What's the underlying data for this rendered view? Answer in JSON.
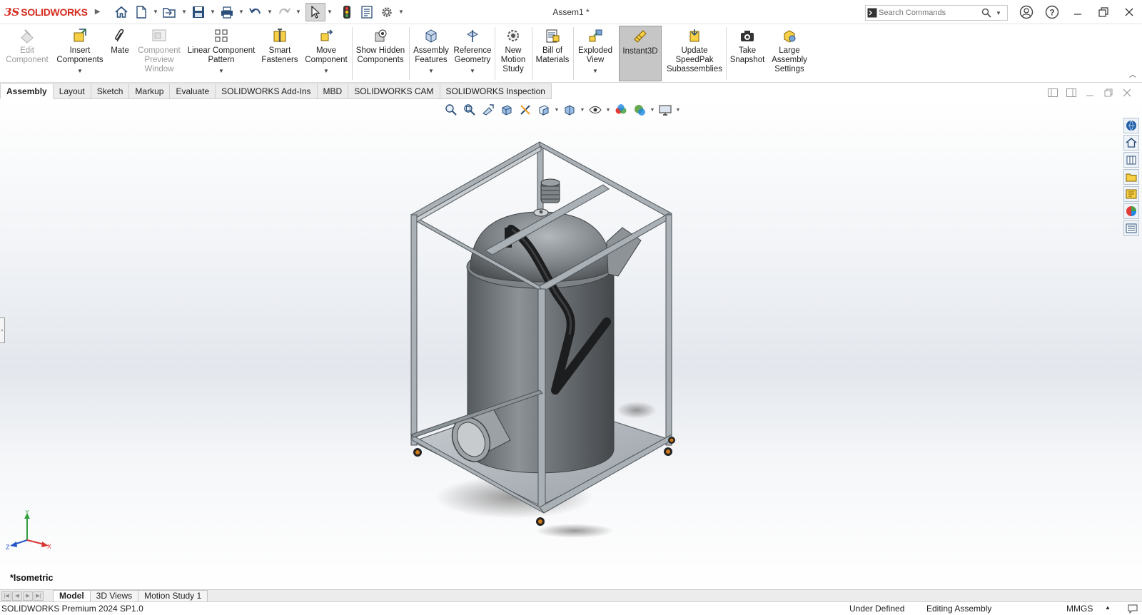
{
  "app": {
    "brand_prefix": "3S",
    "brand_name": "SOLIDWORKS",
    "document_title": "Assem1 *"
  },
  "search": {
    "placeholder": "Search Commands"
  },
  "ribbon": {
    "buttons": [
      {
        "label": "Edit Component",
        "icon": "edit-component-icon",
        "enabled": false
      },
      {
        "label": "Insert Components",
        "icon": "insert-components-icon",
        "enabled": true
      },
      {
        "label": "Mate",
        "icon": "mate-paperclip-icon",
        "enabled": true
      },
      {
        "label": "Component Preview Window",
        "icon": "component-preview-icon",
        "enabled": false
      },
      {
        "label": "Linear Component Pattern",
        "icon": "linear-pattern-icon",
        "enabled": true
      },
      {
        "label": "Smart Fasteners",
        "icon": "smart-fasteners-icon",
        "enabled": true
      },
      {
        "label": "Move Component",
        "icon": "move-component-icon",
        "enabled": true
      },
      {
        "label": "Show Hidden Components",
        "icon": "show-hidden-icon",
        "enabled": true
      },
      {
        "label": "Assembly Features",
        "icon": "assembly-features-icon",
        "enabled": true
      },
      {
        "label": "Reference Geometry",
        "icon": "reference-geometry-icon",
        "enabled": true
      },
      {
        "label": "New Motion Study",
        "icon": "motion-study-icon",
        "enabled": true
      },
      {
        "label": "Bill of Materials",
        "icon": "bom-icon",
        "enabled": true
      },
      {
        "label": "Exploded View",
        "icon": "exploded-view-icon",
        "enabled": true
      },
      {
        "label": "Instant3D",
        "icon": "instant3d-icon",
        "enabled": true,
        "active": true
      },
      {
        "label": "Update SpeedPak Subassemblies",
        "icon": "speedpak-icon",
        "enabled": true
      },
      {
        "label": "Take Snapshot",
        "icon": "camera-icon",
        "enabled": true
      },
      {
        "label": "Large Assembly Settings",
        "icon": "large-assembly-icon",
        "enabled": true
      }
    ]
  },
  "command_tabs": [
    "Assembly",
    "Layout",
    "Sketch",
    "Markup",
    "Evaluate",
    "SOLIDWORKS Add-Ins",
    "MBD",
    "SOLIDWORKS CAM",
    "SOLIDWORKS Inspection"
  ],
  "command_tabs_active": "Assembly",
  "viewport": {
    "view_orientation": "*Isometric",
    "triad_labels": {
      "x": "X",
      "y": "Y",
      "z": "Z"
    },
    "hud_tools": [
      "zoom-to-fit-icon",
      "zoom-to-area-icon",
      "previous-view-icon",
      "section-view-icon",
      "dynamic-annotation-icon",
      "view-orientation-icon",
      "display-style-icon",
      "hide-show-items-icon",
      "edit-appearance-icon",
      "apply-scene-icon",
      "view-settings-icon"
    ],
    "task_pane": [
      "solidworks-resources-icon",
      "home-icon",
      "design-library-icon",
      "file-explorer-icon",
      "view-palette-icon",
      "appearances-icon",
      "custom-properties-icon"
    ]
  },
  "bottom_tabs": [
    "Model",
    "3D Views",
    "Motion Study 1"
  ],
  "bottom_tabs_active": "Model",
  "status": {
    "product": "SOLIDWORKS Premium 2024 SP1.0",
    "definition": "Under Defined",
    "mode": "Editing Assembly",
    "units": "MMGS"
  },
  "colors": {
    "brand": "#d52b1e",
    "active_tool_bg": "#c6c6c6",
    "model_grey": "#6d7276",
    "frame_grey": "#a9b0b6"
  }
}
